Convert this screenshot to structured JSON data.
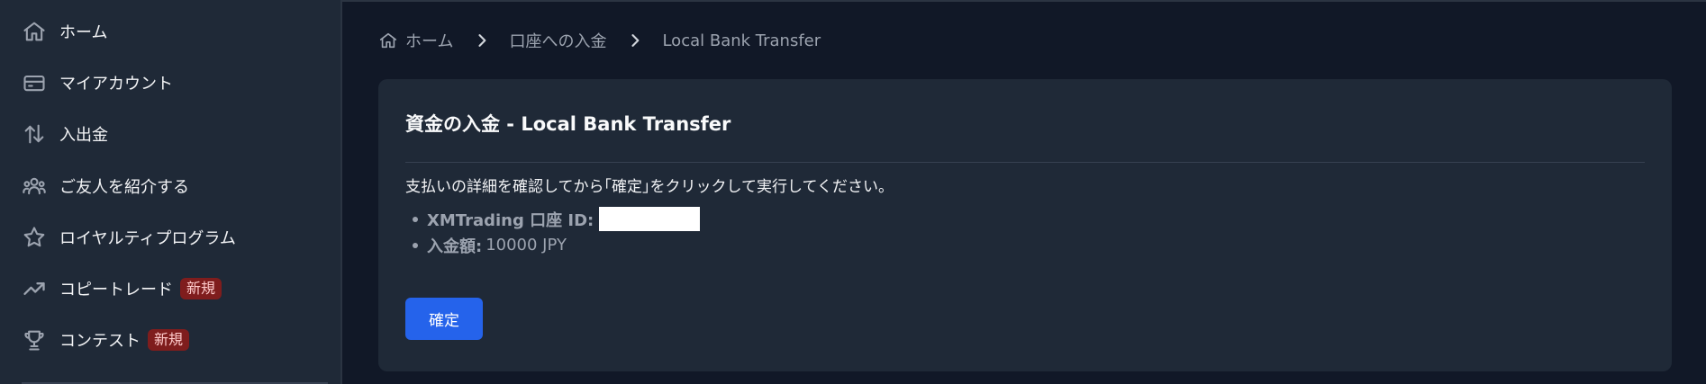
{
  "sidebar": {
    "items": [
      {
        "label": "ホーム",
        "icon": "home-icon"
      },
      {
        "label": "マイアカウント",
        "icon": "card-icon"
      },
      {
        "label": "入出金",
        "icon": "transfer-arrows-icon"
      },
      {
        "label": "ご友人を紹介する",
        "icon": "users-icon"
      },
      {
        "label": "ロイヤルティプログラム",
        "icon": "star-icon"
      },
      {
        "label": "コピートレード",
        "icon": "trending-up-icon",
        "badge": "新規"
      },
      {
        "label": "コンテスト",
        "icon": "trophy-icon",
        "badge": "新規"
      }
    ]
  },
  "breadcrumb": {
    "items": [
      {
        "label": "ホーム"
      },
      {
        "label": "口座への入金"
      },
      {
        "label": "Local Bank Transfer"
      }
    ]
  },
  "card": {
    "title": "資金の入金 - Local Bank Transfer",
    "instruction": "支払いの詳細を確認してから｢確定｣をクリックして実行してください。",
    "details": [
      {
        "label": "XMTrading 口座 ID:",
        "value": ""
      },
      {
        "label": "入金額:",
        "value": "10000 JPY"
      }
    ],
    "confirm_label": "確定"
  },
  "colors": {
    "accent": "#2563eb",
    "badge_bg": "#7f1d1d",
    "sidebar_bg": "#1f2937",
    "main_bg": "#111827"
  }
}
